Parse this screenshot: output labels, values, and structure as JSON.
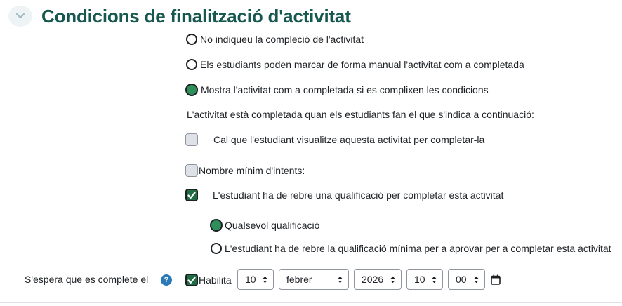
{
  "section": {
    "title": "Condicions de finalització d'activitat"
  },
  "completion": {
    "options": [
      {
        "label": "No indiqueu la compleció de l'activitat",
        "selected": false
      },
      {
        "label": "Els estudiants poden marcar de forma manual l'activitat com a completada",
        "selected": false
      },
      {
        "label": "Mostra l'activitat com a completada si es complixen les condicions",
        "selected": true
      }
    ],
    "intro": "L'activitat està completada quan els estudiants fan el que s'indica a continuació:",
    "view_label": "Cal que l'estudiant visualitze aquesta activitat per completar-la",
    "view_checked": false,
    "attempts_label": "Nombre mínim d'intents:",
    "attempts_checked": false,
    "grade_label": "L'estudiant ha de rebre una qualificació per completar esta activitat",
    "grade_checked": true,
    "grade_options": [
      {
        "label": "Qualsevol qualificació",
        "selected": true
      },
      {
        "label": "L'estudiant ha de rebre la qualificació mínima per a aprovar per a completar esta activitat",
        "selected": false
      }
    ]
  },
  "expected": {
    "label": "S'espera que es complete el",
    "help": "?",
    "enable_label": "Habilita",
    "enable_checked": true,
    "day": "10",
    "month": "febrer",
    "year": "2026",
    "hour": "10",
    "minute": "00"
  },
  "colors": {
    "title": "#16574f",
    "radio_selected": "#2f8f5b",
    "checkbox_checked": "#1f6e43",
    "help_icon": "#2b7ab8"
  },
  "icons": [
    "chevron-down-icon",
    "calendar-icon",
    "help-icon",
    "check-icon"
  ]
}
